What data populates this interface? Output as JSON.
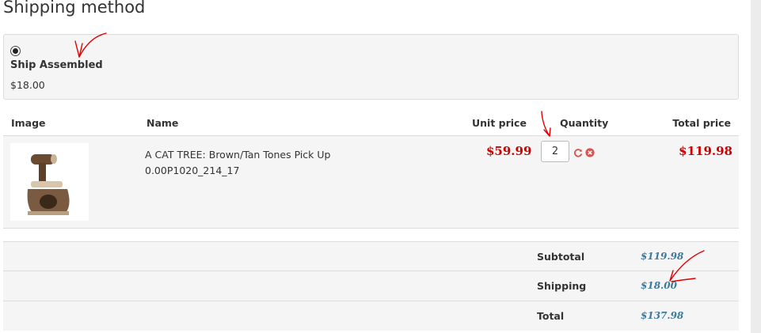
{
  "shipping": {
    "title": "Shipping method",
    "method_name": "Ship Assembled",
    "method_price": "$18.00",
    "selected": true
  },
  "cart": {
    "headers": {
      "image": "Image",
      "name": "Name",
      "unit_price": "Unit price",
      "quantity": "Quantity",
      "total_price": "Total price"
    },
    "items": [
      {
        "name_line1": "A CAT TREE: Brown/Tan Tones Pick Up",
        "name_line2": "0.00P1020_214_17",
        "unit_price": "$59.99",
        "quantity": "2",
        "total_price": "$119.98"
      }
    ]
  },
  "totals": {
    "subtotal_label": "Subtotal",
    "subtotal_value": "$119.98",
    "shipping_label": "Shipping",
    "shipping_value": "$18.00",
    "total_label": "Total",
    "total_value": "$137.98"
  },
  "colors": {
    "price_red": "#cc0000",
    "totals_blue": "#3b7a9c",
    "annotation_red": "#e00000"
  }
}
